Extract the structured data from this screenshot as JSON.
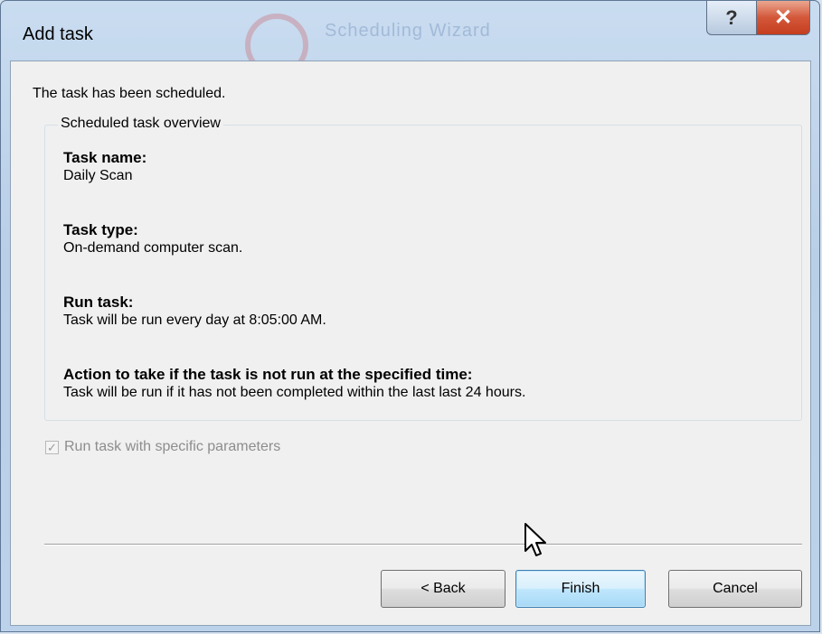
{
  "window": {
    "title": "Add task",
    "ghost_title": "Scheduling Wizard",
    "help_glyph": "?",
    "close_glyph": "✕"
  },
  "content": {
    "intro": "The task has been scheduled.",
    "group_title": "Scheduled task overview",
    "sections": [
      {
        "heading": "Task name:",
        "value": "Daily Scan"
      },
      {
        "heading": "Task type:",
        "value": "On-demand computer scan."
      },
      {
        "heading": "Run task:",
        "value": "Task will be run every day at 8:05:00 AM."
      },
      {
        "heading": "Action to take if the task is not run at the specified time:",
        "value": "Task will be run if it has not been completed within the last last 24 hours."
      }
    ],
    "checkbox": {
      "label": "Run task with specific parameters",
      "checked": true,
      "enabled": false,
      "glyph": "✓"
    }
  },
  "buttons": {
    "back": "< Back",
    "finish": "Finish",
    "cancel": "Cancel"
  },
  "colors": {
    "frame": "#b9cfe8",
    "client": "#f0f0f0",
    "close": "#c53e1f",
    "focus_button": "#3c7fb1"
  }
}
